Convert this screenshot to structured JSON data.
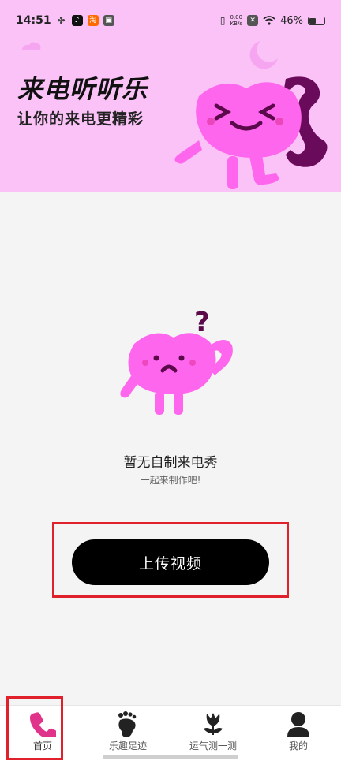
{
  "status_bar": {
    "time": "14:51",
    "net_speed_value": "0.00",
    "net_speed_unit": "KB/s",
    "battery": "46%"
  },
  "banner": {
    "title": "来电听听乐",
    "subtitle": "让你的来电更精彩"
  },
  "empty_state": {
    "title": "暂无自制来电秀",
    "subtitle": "一起来制作吧!"
  },
  "upload_button": {
    "label": "上传视频"
  },
  "bottom_nav": {
    "items": [
      {
        "label": "首页",
        "icon": "phone-icon",
        "active": true
      },
      {
        "label": "乐趣足迹",
        "icon": "footprint-icon"
      },
      {
        "label": "运气测一测",
        "icon": "tulip-icon"
      },
      {
        "label": "我的",
        "icon": "user-icon"
      }
    ]
  },
  "colors": {
    "banner_bg": "#fac2f7",
    "mascot_pink": "#ff66ee",
    "accent_purple": "#6a0a5a",
    "button_bg": "#000000",
    "highlight_red": "#e0202a"
  }
}
